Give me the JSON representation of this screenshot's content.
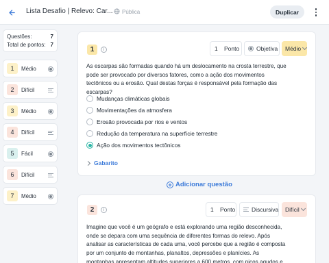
{
  "header": {
    "title": "Lista Desafio | Relevo: Car...",
    "visibility": "Pública",
    "duplicate_label": "Duplicar"
  },
  "summary": {
    "questions_label": "Questões:",
    "questions_value": "7",
    "points_label": "Total de pontos:",
    "points_value": "7"
  },
  "sidebar": {
    "items": [
      {
        "number": "1",
        "difficulty": "Médio",
        "icon": "radio-icon"
      },
      {
        "number": "2",
        "difficulty": "Difícil",
        "icon": "text-lines-icon"
      },
      {
        "number": "3",
        "difficulty": "Médio",
        "icon": "radio-icon"
      },
      {
        "number": "4",
        "difficulty": "Difícil",
        "icon": "text-lines-icon"
      },
      {
        "number": "5",
        "difficulty": "Fácil",
        "icon": "radio-icon"
      },
      {
        "number": "6",
        "difficulty": "Difícil",
        "icon": "text-lines-icon"
      },
      {
        "number": "7",
        "difficulty": "Médio",
        "icon": "radio-icon"
      }
    ]
  },
  "questions": [
    {
      "number": "1",
      "points_value": "1",
      "points_unit": "Ponto",
      "type": "Objetiva",
      "difficulty": "Médio",
      "text": "As escarpas são formadas quando há um deslocamento na crosta terrestre, que pode ser provocado por diversos fatores, como a ação dos movimentos tectônicos ou a erosão. Qual destas forças é responsável pela formação das escarpas?",
      "options": [
        "Mudanças climáticas globais",
        "Movimentações da atmosfera",
        "Erosão provocada por rios e ventos",
        "Redução da temperatura na superfície terrestre",
        "Ação dos movimentos tectônicos"
      ],
      "selected_index": 4,
      "answer_key_label": "Gabarito"
    },
    {
      "number": "2",
      "points_value": "1",
      "points_unit": "Ponto",
      "type": "Discursiva",
      "difficulty": "Difícil",
      "text": "Imagine que você é um geógrafo e está explorando uma região desconhecida, onde se depara com uma sequência de diferentes formas do relevo. Após analisar as características de cada uma, você percebe que a região é composta por um conjunto de montanhas, planaltos, depressões e planícies. As montanhas apresentam altitudes superiores a 600 metros, com picos agudos e vales"
    }
  ],
  "add_question_label": "Adicionar questão",
  "colors": {
    "accent": "#3d7bd9",
    "selected": "#2bb5a5",
    "medio": "#fdf1c8",
    "dificil": "#fbe4dc",
    "facil": "#d9f0ee"
  }
}
